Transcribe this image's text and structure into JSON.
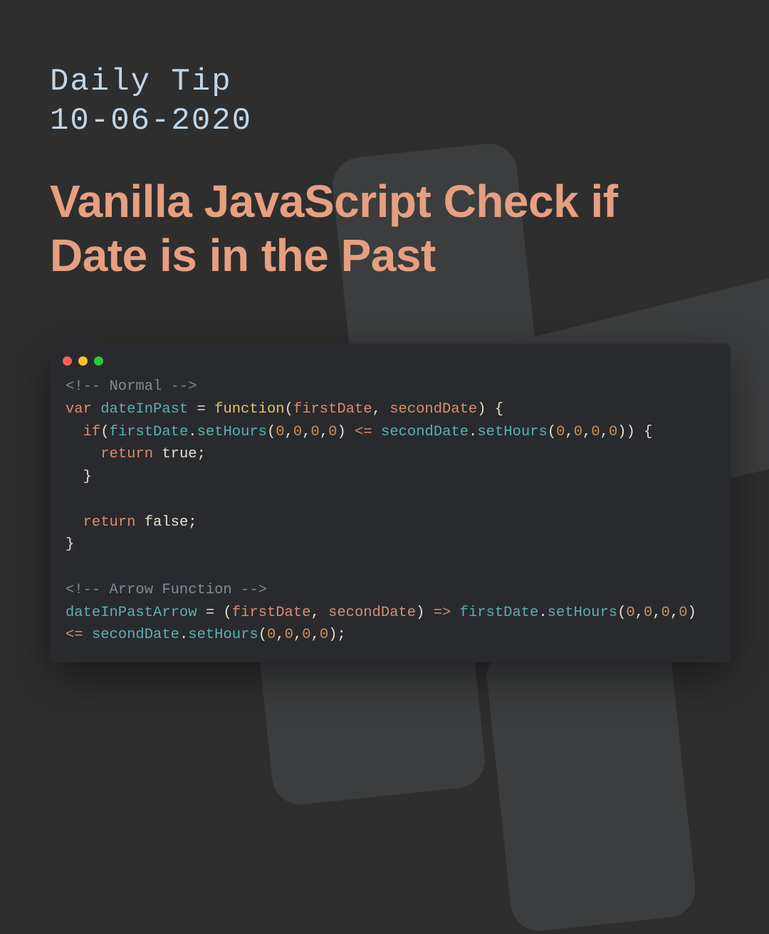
{
  "eyebrow": {
    "line1": "Daily Tip",
    "line2": "10-06-2020"
  },
  "title": "Vanilla JavaScript Check if Date is in the Past",
  "code": {
    "comment1": "<!-- Normal -->",
    "l2": {
      "kw": "var",
      "name": "dateInPast",
      "eq": " = ",
      "fn": "function",
      "open": "(",
      "p1": "firstDate",
      "comma": ", ",
      "p2": "secondDate",
      "close": ") {"
    },
    "l3": {
      "indent": "  ",
      "ifkw": "if",
      "open": "(",
      "v1": "firstDate",
      "dot1": ".",
      "m1": "setHours",
      "args1": "(",
      "n": "0",
      "c": ",",
      "argsEnd": ") ",
      "op": "<=",
      "sp": " ",
      "v2": "secondDate",
      "dot2": ".",
      "m2": "setHours",
      "args2open": "(",
      "args2end": ")) {"
    },
    "l4": {
      "indent": "    ",
      "ret": "return",
      "sp": " ",
      "val": "true",
      "semi": ";"
    },
    "l5": "  }",
    "l6": "",
    "l7": {
      "indent": "  ",
      "ret": "return",
      "sp": " ",
      "val": "false",
      "semi": ";"
    },
    "l8": "}",
    "comment2": "<!-- Arrow Function -->",
    "l10": {
      "name": "dateInPastArrow",
      "eq": " = (",
      "p1": "firstDate",
      "comma": ", ",
      "p2": "secondDate",
      "close": ") ",
      "arrow": "=>",
      "sp": " ",
      "v1": "firstDate",
      "dot": ".",
      "m": "setHours",
      "open": "(",
      "end": ")"
    },
    "l11": {
      "op": "<=",
      "sp": " ",
      "v2": "secondDate",
      "dot": ".",
      "m": "setHours",
      "open": "(",
      "end": ");"
    }
  }
}
